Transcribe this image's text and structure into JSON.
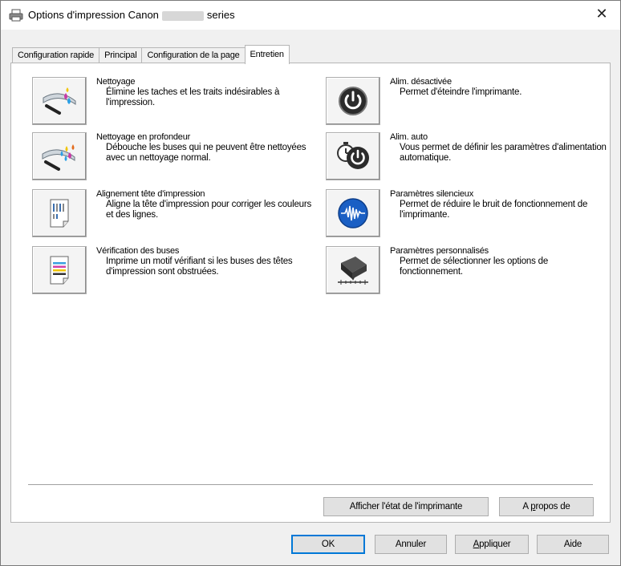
{
  "window": {
    "title_prefix": "Options d'impression Canon",
    "title_suffix": "series"
  },
  "tabs": [
    {
      "label": "Configuration rapide"
    },
    {
      "label": "Principal"
    },
    {
      "label": "Configuration de la page"
    },
    {
      "label": "Entretien",
      "active": true
    }
  ],
  "left_items": [
    {
      "title": "Nettoyage",
      "desc": "Élimine les taches et les traits indésirables à l'impression.",
      "icon": "cleaning-icon"
    },
    {
      "title": "Nettoyage en profondeur",
      "desc": "Débouche les buses qui ne peuvent être nettoyées avec un nettoyage normal.",
      "icon": "deep-cleaning-icon"
    },
    {
      "title": "Alignement tête d'impression",
      "desc": "Aligne la tête d'impression pour corriger les couleurs et des lignes.",
      "icon": "print-head-alignment-icon"
    },
    {
      "title": "Vérification des buses",
      "desc": "Imprime un motif vérifiant si les buses des têtes d'impression sont obstruées.",
      "icon": "nozzle-check-icon"
    }
  ],
  "right_items": [
    {
      "title": "Alim. désactivée",
      "desc": "Permet d'éteindre l'imprimante.",
      "icon": "power-off-icon"
    },
    {
      "title": "Alim. auto",
      "desc": "Vous permet de définir les paramètres d'alimentation automatique.",
      "icon": "auto-power-icon"
    },
    {
      "title": "Paramètres silencieux",
      "desc": "Permet de réduire le bruit de fonctionnement de l'imprimante.",
      "icon": "quiet-settings-icon"
    },
    {
      "title": "Paramètres personnalisés",
      "desc": "Permet de sélectionner les options de fonctionnement.",
      "icon": "custom-settings-icon"
    }
  ],
  "panel_buttons": {
    "status": "Afficher l'état de l'imprimante",
    "about_prefix": "A ",
    "about_access": "p",
    "about_rest": "ropos de"
  },
  "dialog_buttons": {
    "ok": "OK",
    "cancel": "Annuler",
    "apply_access": "A",
    "apply_rest": "ppliquer",
    "help": "Aide"
  }
}
